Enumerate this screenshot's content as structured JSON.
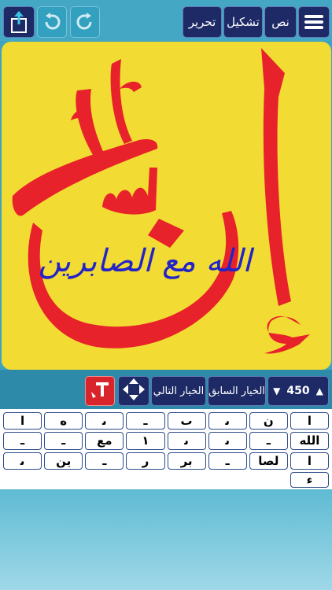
{
  "toolbar": {
    "menu_icon": "hamburger-menu-icon",
    "text_label": "نص",
    "diacritics_label": "تشكيل",
    "edit_label": "تحرير",
    "redo_icon": "redo-arrow-icon",
    "undo_icon": "undo-arrow-icon",
    "share_icon": "share-export-icon"
  },
  "canvas": {
    "background_color": "#f2dc33",
    "large_letters_color": "#e8222a",
    "phrase_color": "#2323c8",
    "large_text": "إن",
    "phrase": "الله مع الصابرين"
  },
  "controls": {
    "counter_value": "450",
    "counter_down": "▼",
    "counter_up": "▲",
    "previous_option": "الخيار السابق",
    "next_option": "الخيار التالي",
    "move_icon": "four-way-arrows-icon",
    "text_style_icon": "text-color-icon"
  },
  "keyboard": {
    "keys": [
      "ا",
      "ن",
      "ﯨ",
      "ٮ",
      "ـ",
      "ﯨ",
      "ه",
      "ا",
      "الله",
      "ـ",
      "ﯨ",
      "ﯨ",
      "١",
      "مع",
      "ـ",
      "ـ",
      "ا",
      "لصا",
      "ـ",
      "بر",
      "ﺭ",
      "ـ",
      "ين",
      "ﯨ",
      "ﺀ"
    ]
  }
}
